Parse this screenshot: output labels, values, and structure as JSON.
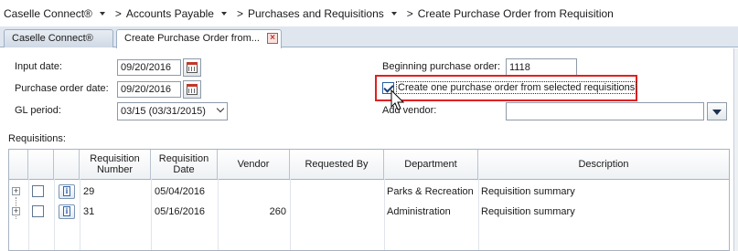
{
  "breadcrumb": {
    "items": [
      "Caselle Connect®",
      "Accounts Payable",
      "Purchases and Requisitions",
      "Create Purchase Order from Requisition"
    ],
    "separator": ">"
  },
  "tabs": [
    {
      "label": "Caselle Connect®",
      "active": false
    },
    {
      "label": "Create Purchase Order from...",
      "active": true
    }
  ],
  "form": {
    "input_date_label": "Input date:",
    "input_date_value": "09/20/2016",
    "po_date_label": "Purchase order date:",
    "po_date_value": "09/20/2016",
    "gl_period_label": "GL period:",
    "gl_period_value": "03/15 (03/31/2015)",
    "beginning_po_label": "Beginning purchase order:",
    "beginning_po_value": "1118",
    "create_one_po_label": "Create one purchase order from selected requisitions",
    "create_one_po_checked": true,
    "add_vendor_label": "Add vendor:",
    "add_vendor_value": ""
  },
  "grid": {
    "title": "Requisitions:",
    "columns": [
      "Requisition Number",
      "Requisition Date",
      "Vendor",
      "Requested By",
      "Department",
      "Description"
    ],
    "rows": [
      {
        "number": "29",
        "date": "05/04/2016",
        "vendor": "",
        "requested_by": "",
        "department": "Parks & Recreation",
        "description": "Requisition summary"
      },
      {
        "number": "31",
        "date": "05/16/2016",
        "vendor": "260",
        "requested_by": "",
        "department": "Administration",
        "description": "Requisition summary"
      }
    ]
  },
  "colors": {
    "highlight_border": "#e02020",
    "tab_bar": "#dfe6ee",
    "close_button": "#c0392b"
  }
}
